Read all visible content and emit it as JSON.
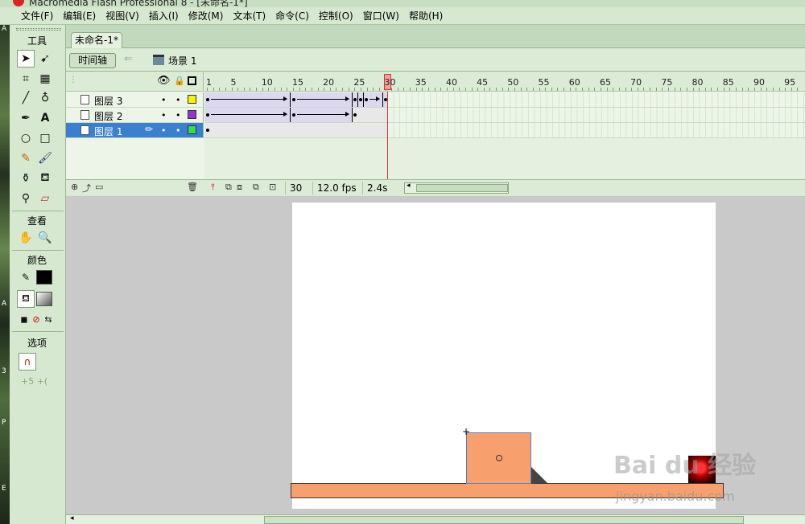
{
  "window": {
    "title": "Macromedia Flash Professional 8 - [未命名-1*]"
  },
  "menu": [
    "文件(F)",
    "编辑(E)",
    "视图(V)",
    "插入(I)",
    "修改(M)",
    "文本(T)",
    "命令(C)",
    "控制(O)",
    "窗口(W)",
    "帮助(H)"
  ],
  "desktop_letters": [
    "A",
    "A",
    "3",
    "P",
    "E"
  ],
  "tools": {
    "title": "工具",
    "view_title": "查看",
    "colors_title": "颜色",
    "options_title": "选项",
    "items": [
      {
        "name": "selection-tool-icon",
        "glyph": "➤"
      },
      {
        "name": "subselection-tool-icon",
        "glyph": "➹"
      },
      {
        "name": "free-transform-tool-icon",
        "glyph": "⌗"
      },
      {
        "name": "fill-transform-tool-icon",
        "glyph": "▦"
      },
      {
        "name": "line-tool-icon",
        "glyph": "╱"
      },
      {
        "name": "lasso-tool-icon",
        "glyph": "♁"
      },
      {
        "name": "pen-tool-icon",
        "glyph": "✒"
      },
      {
        "name": "text-tool-icon",
        "glyph": "A"
      },
      {
        "name": "oval-tool-icon",
        "glyph": "○"
      },
      {
        "name": "rectangle-tool-icon",
        "glyph": "□"
      },
      {
        "name": "pencil-tool-icon",
        "glyph": "✎"
      },
      {
        "name": "brush-tool-icon",
        "glyph": "🖌"
      },
      {
        "name": "ink-bottle-tool-icon",
        "glyph": "⚱"
      },
      {
        "name": "paint-bucket-tool-icon",
        "glyph": "⛾"
      },
      {
        "name": "eyedropper-tool-icon",
        "glyph": "⚲"
      },
      {
        "name": "eraser-tool-icon",
        "glyph": "▱"
      }
    ],
    "view_items": [
      {
        "name": "hand-tool-icon",
        "glyph": "✋"
      },
      {
        "name": "zoom-tool-icon",
        "glyph": "🔍"
      }
    ],
    "stroke_color": "#000000",
    "fill_color": "#555555",
    "options_extra": "+5 +("
  },
  "document": {
    "tab_label": "未命名-1*",
    "timeline_button": "时间轴",
    "scene_label": "场景 1"
  },
  "timeline": {
    "ruler_labels": [
      "1",
      "5",
      "10",
      "15",
      "20",
      "25",
      "30",
      "35",
      "40",
      "45",
      "50",
      "55",
      "60",
      "65",
      "70",
      "75",
      "80",
      "85",
      "90",
      "95"
    ],
    "current_frame": 30,
    "layers": [
      {
        "name": "图层 3",
        "color": "#f5f500",
        "selected": false
      },
      {
        "name": "图层 2",
        "color": "#9933cc",
        "selected": false
      },
      {
        "name": "图层 1",
        "color": "#33dd55",
        "selected": true
      }
    ],
    "footer": {
      "frame": "30",
      "fps": "12.0 fps",
      "time": "2.4s"
    }
  },
  "stage": {
    "background": "#ffffff",
    "shape_color": "#f7a06e",
    "watermark": "Bai du 经验",
    "watermark_sub": "jingyan.baidu.com"
  }
}
